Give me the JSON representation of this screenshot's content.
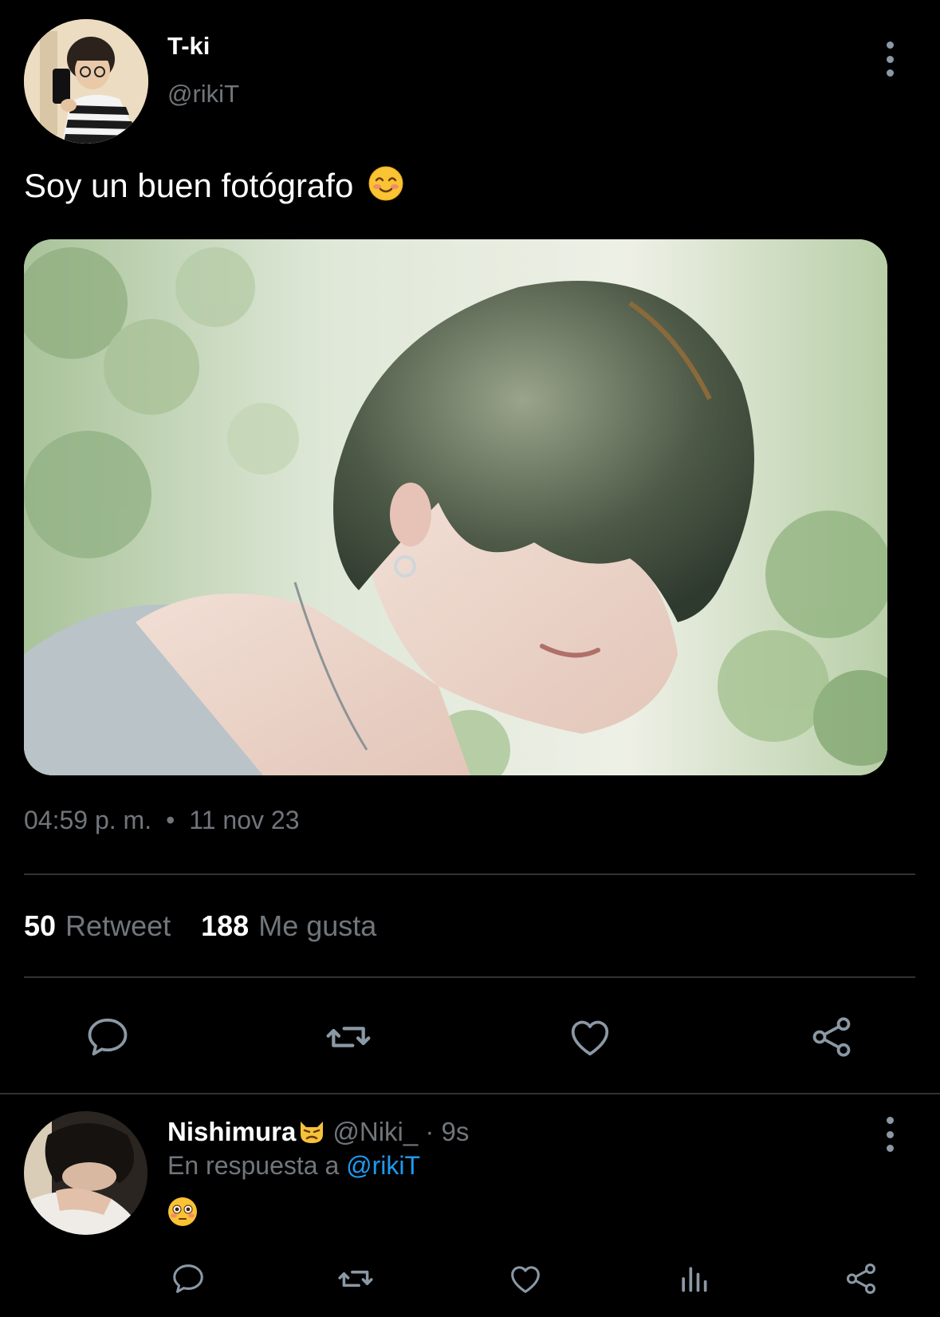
{
  "tweet": {
    "author_name": "T-ki",
    "author_handle": "@rikiT",
    "text": "Soy un buen fotógrafo",
    "text_emoji": "smiling-face-icon",
    "time": "04:59 p. m.",
    "separator": "•",
    "date": "11 nov 23",
    "stats": {
      "retweets_count": "50",
      "retweets_label": "Retweet",
      "likes_count": "188",
      "likes_label": "Me gusta"
    },
    "actions": [
      "reply-icon",
      "retweet-icon",
      "like-icon",
      "share-icon"
    ]
  },
  "reply": {
    "author_name": "Nishimura",
    "name_emoji": "pouting-cat-icon",
    "handle_time": "@Niki_ · 9s",
    "in_reply_prefix": "En respuesta a",
    "in_reply_mention": "@rikiT",
    "body_emoji": "flushed-face-icon",
    "actions": [
      "reply-icon",
      "retweet-icon",
      "like-icon",
      "analytics-icon",
      "share-icon"
    ]
  },
  "colors": {
    "background": "#000000",
    "primary_text": "#ffffff",
    "secondary_text": "#71767b",
    "icon": "#8b98a5",
    "link": "#1d9bf0",
    "divider": "#2f3336"
  }
}
